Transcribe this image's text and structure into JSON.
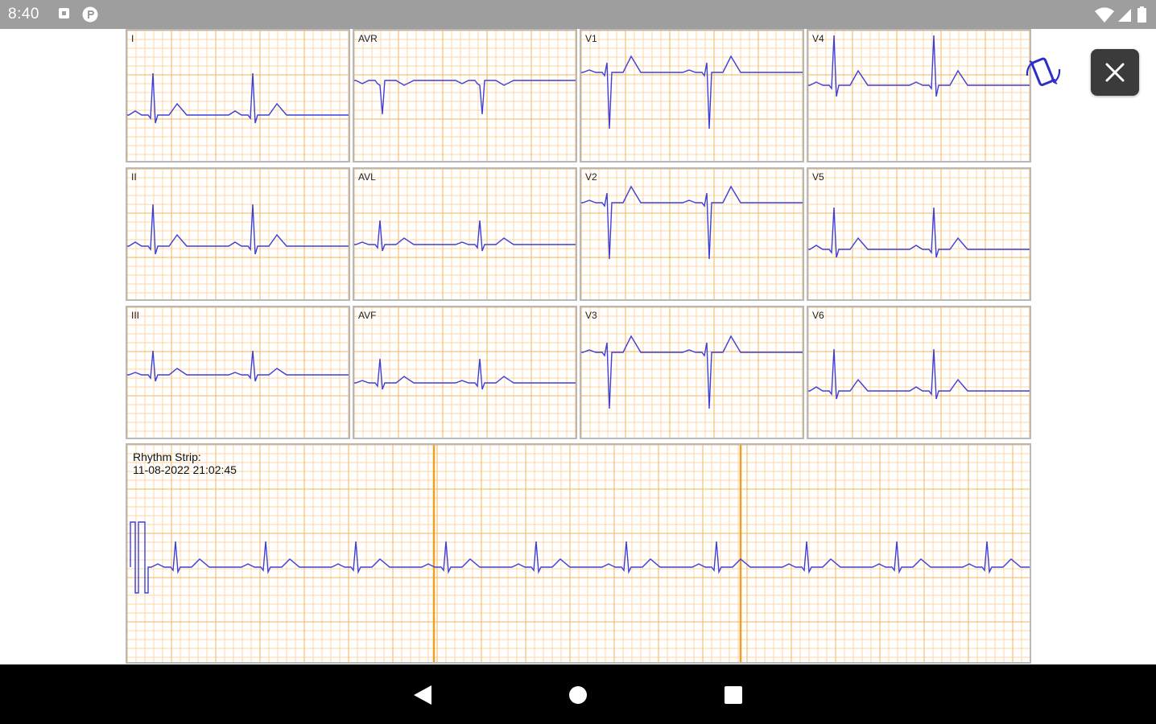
{
  "status_bar": {
    "time": "8:40",
    "icons": [
      "notification-square-icon",
      "p-circle-icon",
      "wifi-icon",
      "signal-icon",
      "battery-icon"
    ]
  },
  "ecg": {
    "grid_minor_color": "#fbd9a6",
    "grid_major_color": "#f5b35a",
    "trace_color": "#3f3fd8",
    "leads": [
      "I",
      "AVR",
      "V1",
      "V4",
      "II",
      "AVL",
      "V2",
      "V5",
      "III",
      "AVF",
      "V3",
      "V6"
    ],
    "rhythm_strip": {
      "title": "Rhythm Strip:",
      "timestamp": "11-08-2022 21:02:45"
    }
  },
  "controls": {
    "close_icon": "close-icon",
    "rotate_icon": "screen-rotation-icon"
  },
  "nav_bar": {
    "icons": [
      "back-icon",
      "home-icon",
      "recents-icon"
    ]
  }
}
